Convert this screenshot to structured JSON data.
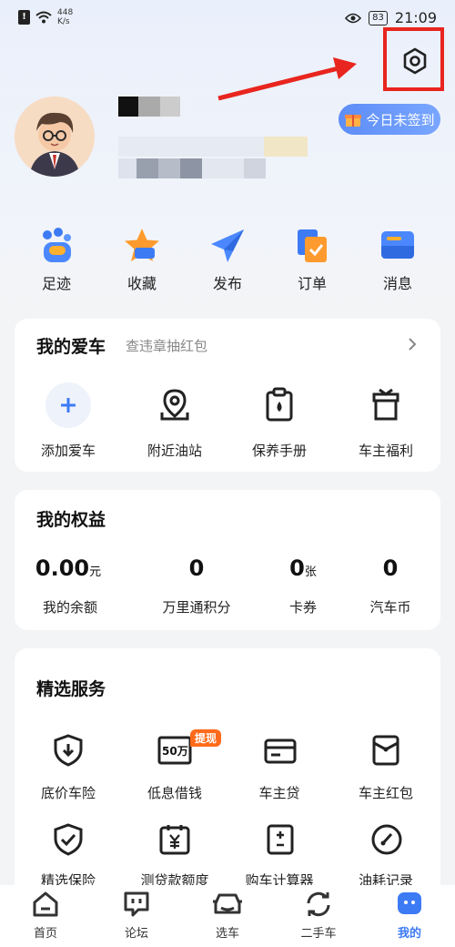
{
  "status_bar": {
    "speed_value": "448",
    "speed_unit": "K/s",
    "battery": "83",
    "time": "21:09"
  },
  "header": {
    "checkin_label": "今日未签到"
  },
  "quick_actions": [
    {
      "label": "足迹",
      "icon": "footprint-icon"
    },
    {
      "label": "收藏",
      "icon": "star-icon"
    },
    {
      "label": "发布",
      "icon": "paper-plane-icon"
    },
    {
      "label": "订单",
      "icon": "order-icon"
    },
    {
      "label": "消息",
      "icon": "message-icon"
    }
  ],
  "my_car": {
    "title": "我的爱车",
    "subtitle": "查违章抽红包",
    "items": [
      {
        "label": "添加爱车",
        "icon": "plus-icon"
      },
      {
        "label": "附近油站",
        "icon": "location-icon"
      },
      {
        "label": "保养手册",
        "icon": "manual-icon"
      },
      {
        "label": "车主福利",
        "icon": "gift-icon"
      }
    ]
  },
  "benefits": {
    "title": "我的权益",
    "items": [
      {
        "value": "0.00",
        "unit": "元",
        "label": "我的余额"
      },
      {
        "value": "0",
        "unit": "",
        "label": "万里通积分"
      },
      {
        "value": "0",
        "unit": "张",
        "label": "卡券"
      },
      {
        "value": "0",
        "unit": "",
        "label": "汽车币"
      }
    ]
  },
  "services": {
    "title": "精选服务",
    "badge": "提现",
    "loan_icon_text": "50万",
    "items": [
      {
        "label": "底价车险",
        "icon": "shield-download-icon"
      },
      {
        "label": "低息借钱",
        "icon": "loan-icon"
      },
      {
        "label": "车主贷",
        "icon": "card-icon"
      },
      {
        "label": "车主红包",
        "icon": "red-envelope-icon"
      },
      {
        "label": "精选保险",
        "icon": "shield-check-icon"
      },
      {
        "label": "测贷款额度",
        "icon": "calendar-yuan-icon"
      },
      {
        "label": "购车计算器",
        "icon": "calculator-icon"
      },
      {
        "label": "油耗记录",
        "icon": "gauge-icon"
      }
    ]
  },
  "tabbar": [
    {
      "label": "首页",
      "icon": "home-icon"
    },
    {
      "label": "论坛",
      "icon": "forum-icon"
    },
    {
      "label": "选车",
      "icon": "car-icon"
    },
    {
      "label": "二手车",
      "icon": "refresh-icon"
    },
    {
      "label": "我的",
      "icon": "profile-icon"
    }
  ],
  "colors": {
    "accent": "#3d7bf5",
    "highlight": "#e8251e",
    "badge": "#ff6a1a"
  }
}
